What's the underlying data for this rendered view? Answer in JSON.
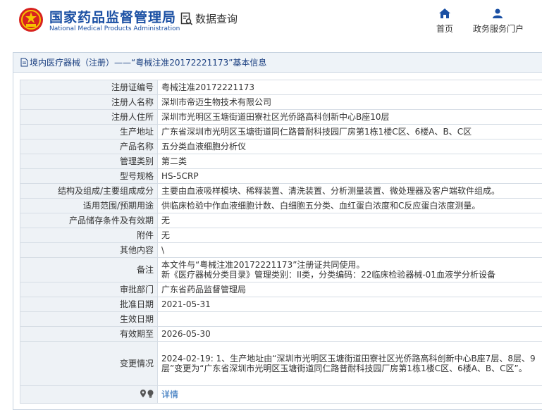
{
  "header": {
    "brand_cn": "国家药品监督管理局",
    "brand_en": "National Medical Products Administration",
    "data_query": "数据查询",
    "nav": {
      "home": "首页",
      "portal": "政务服务门户"
    }
  },
  "panel": {
    "title": "境内医疗器械（注册）——“粤械注准20172221173”基本信息"
  },
  "rows": [
    {
      "label": "注册证编号",
      "value": "粤械注准20172221173"
    },
    {
      "label": "注册人名称",
      "value": "深圳市帝迈生物技术有限公司"
    },
    {
      "label": "注册人住所",
      "value": "深圳市光明区玉塘街道田寮社区光侨路高科创新中心B座10层"
    },
    {
      "label": "生产地址",
      "value": "广东省深圳市光明区玉塘街道同仁路普耐科技园厂房第1栋1楼C区、6楼A、B、C区"
    },
    {
      "label": "产品名称",
      "value": "五分类血液细胞分析仪"
    },
    {
      "label": "管理类别",
      "value": "第二类"
    },
    {
      "label": "型号规格",
      "value": "HS-5CRP"
    },
    {
      "label": "结构及组成/主要组成成分",
      "value": "主要由血液吸样模块、稀释装置、清洗装置、分析测量装置、微处理器及客户端软件组成。"
    },
    {
      "label": "适用范围/预期用途",
      "value": "供临床检验中作血液细胞计数、白细胞五分类、血红蛋白浓度和C反应蛋白浓度测量。"
    },
    {
      "label": "产品储存条件及有效期",
      "value": "无"
    },
    {
      "label": "附件",
      "value": "无"
    },
    {
      "label": "其他内容",
      "value": "\\"
    },
    {
      "label": "备注",
      "value_line1": "本文件与“粤械注准20172221173”注册证共同使用。",
      "value_line2": "新《医疗器械分类目录》管理类别：II类，分类编码：22临床检验器械-01血液学分析设备"
    },
    {
      "label": "审批部门",
      "value": "广东省药品监督管理局"
    },
    {
      "label": "批准日期",
      "value": "2021-05-31"
    },
    {
      "label": "生效日期",
      "value": ""
    },
    {
      "label": "有效期至",
      "value": "2026-05-30"
    },
    {
      "label": "变更情况",
      "value": "2024-02-19: 1、生产地址由“深圳市光明区玉塘街道田寮社区光侨路高科创新中心B座7层、8层、9层”变更为“广东省深圳市光明区玉塘街道同仁路普耐科技园厂房第1栋1楼C区、6楼A、B、C区”。"
    },
    {
      "label_icons": [
        "location-pin-icon",
        "lightbulb-icon"
      ],
      "value": "详情"
    }
  ],
  "colors": {
    "brand": "#1a4fa3",
    "link": "#1a63b5",
    "label_bg": "#eef2f6",
    "title_bg": "#eef3f8",
    "border": "#d6dde5"
  }
}
